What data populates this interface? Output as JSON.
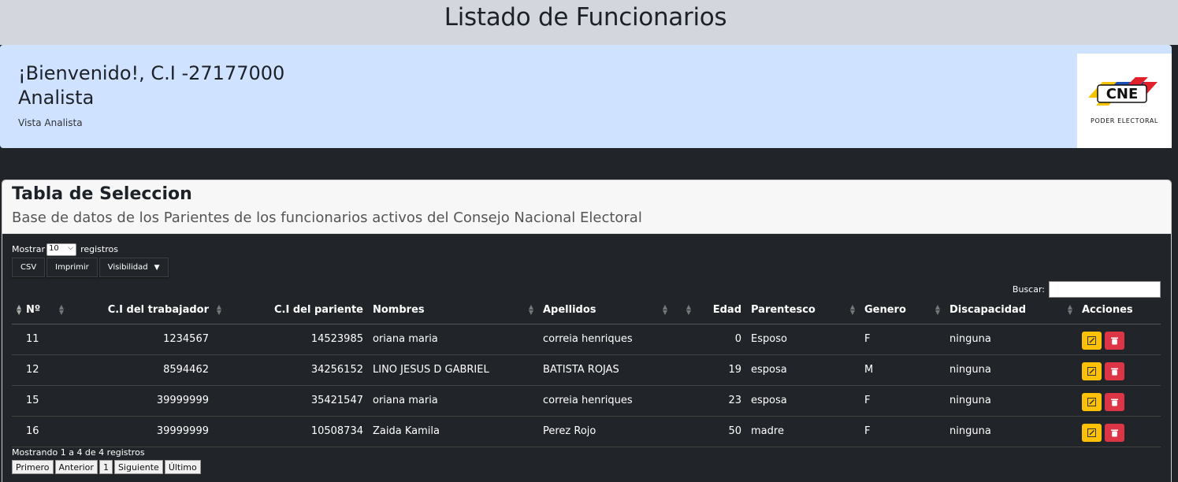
{
  "page_title": "Listado de Funcionarios",
  "welcome": {
    "greeting": "¡Bienvenido!, C.I -27177000",
    "role": "Analista",
    "view": "Vista Analista",
    "logo_text": "PODER ELECTORAL",
    "logo_mark": "CNE"
  },
  "card": {
    "title": "Tabla de Seleccion",
    "subtitle": "Base de datos de los Parientes de los funcionarios activos del Consejo Nacional Electoral"
  },
  "length": {
    "before": "Mostrar",
    "value": "10",
    "after": "registros"
  },
  "buttons": {
    "csv": "CSV",
    "print": "Imprimir",
    "visibility": "Visibilidad"
  },
  "search": {
    "label": "Buscar:"
  },
  "table": {
    "columns": [
      "Nº",
      "C.I del trabajador",
      "C.I del pariente",
      "Nombres",
      "Apellidos",
      "",
      "Edad",
      "Parentesco",
      "Genero",
      "Discapacidad",
      "Acciones"
    ],
    "rows": [
      {
        "n": "11",
        "ci_trab": "1234567",
        "ci_par": "14523985",
        "nombres": "oriana maria",
        "apellidos": "correia henriques",
        "edad": "0",
        "parentesco": "Esposo",
        "genero": "F",
        "discapacidad": "ninguna"
      },
      {
        "n": "12",
        "ci_trab": "8594462",
        "ci_par": "34256152",
        "nombres": "LINO JESUS D GABRIEL",
        "apellidos": "BATISTA ROJAS",
        "edad": "19",
        "parentesco": "esposa",
        "genero": "M",
        "discapacidad": "ninguna"
      },
      {
        "n": "15",
        "ci_trab": "39999999",
        "ci_par": "35421547",
        "nombres": "oriana maria",
        "apellidos": "correia henriques",
        "edad": "23",
        "parentesco": "esposa",
        "genero": "F",
        "discapacidad": "ninguna"
      },
      {
        "n": "16",
        "ci_trab": "39999999",
        "ci_par": "10508734",
        "nombres": "Zaida Kamila",
        "apellidos": "Perez Rojo",
        "edad": "50",
        "parentesco": "madre",
        "genero": "F",
        "discapacidad": "ninguna"
      }
    ]
  },
  "info": "Mostrando 1 a 4 de 4 registros",
  "pager": {
    "first": "Primero",
    "prev": "Anterior",
    "page": "1",
    "next": "Siguiente",
    "last": "Último"
  },
  "colors": {
    "accent_edit": "#ffc107",
    "accent_delete": "#dc3545",
    "welcome_bg": "#cfe2ff",
    "dark_bg": "#212529"
  },
  "icons": {
    "edit": "pencil-square-icon",
    "delete": "trash-icon",
    "sort": "sort-arrows-icon"
  }
}
